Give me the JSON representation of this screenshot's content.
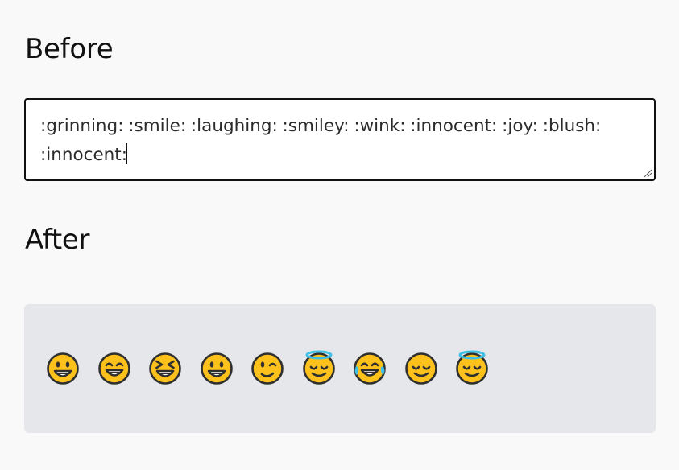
{
  "before_heading": "Before",
  "after_heading": "After",
  "editor": {
    "line1": ":grinning: :smile: :laughing: :smiley: :wink: :innocent: :joy: :blush:",
    "line2": ":innocent:"
  },
  "output": {
    "emojis": [
      "grinning",
      "smile",
      "laughing",
      "smiley",
      "wink",
      "innocent",
      "joy",
      "blush",
      "innocent"
    ]
  },
  "colors": {
    "face": "#fcc21b",
    "outline": "#2f2f2f",
    "halo": "#40c0e7",
    "tears": "#40c0e7",
    "mouth_inner": "#ffffff",
    "background": "#f9f9fa",
    "output_bg": "#e6e7ea"
  }
}
